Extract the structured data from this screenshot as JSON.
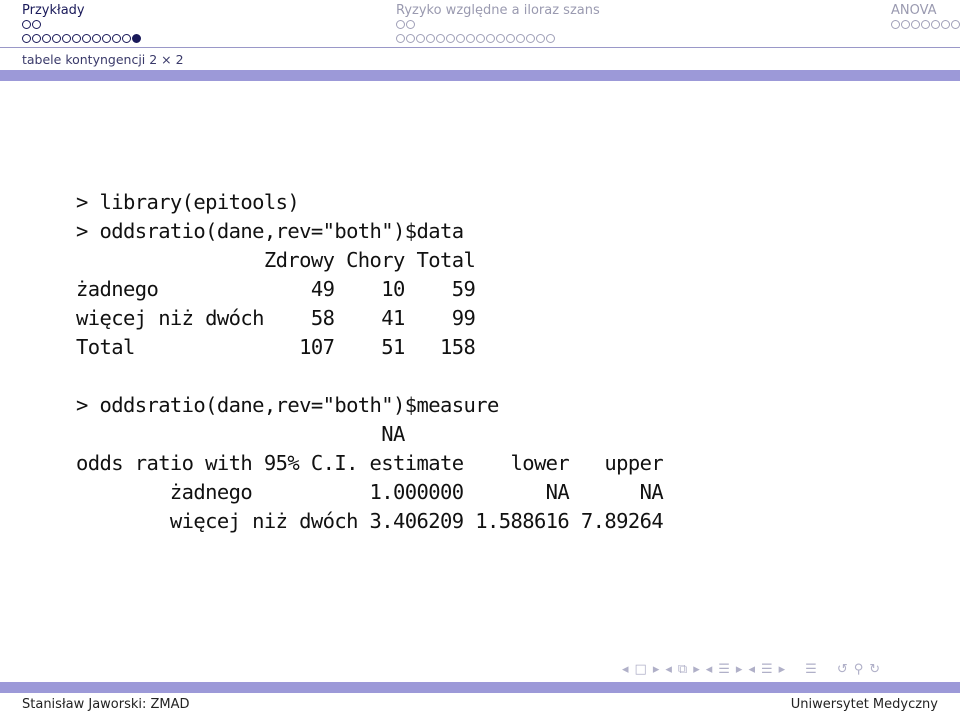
{
  "header": {
    "sections": [
      {
        "title": "Przykłady",
        "active": true,
        "rows": [
          {
            "open": 2,
            "filled": 0
          },
          {
            "open": 11,
            "filled": 1
          }
        ]
      },
      {
        "title": "Ryzyko względne a iloraz szans",
        "active": false,
        "rows": [
          {
            "open": 2,
            "filled": 0
          },
          {
            "open": 16,
            "filled": 0
          }
        ]
      },
      {
        "title": "ANOVA",
        "active": false,
        "rows": [
          {
            "open": 7,
            "filled": 0
          }
        ]
      }
    ],
    "subsection": "tabele kontyngencji 2 × 2"
  },
  "code": {
    "lines": [
      "> library(epitools)",
      "> oddsratio(dane,rev=\"both\")$data",
      "                Zdrowy Chory Total",
      "żadnego             49    10    59",
      "więcej niż dwóch    58    41    99",
      "Total              107    51   158",
      "",
      "> oddsratio(dane,rev=\"both\")$measure",
      "                          NA",
      "odds ratio with 95% C.I. estimate    lower   upper",
      "        żadnego          1.000000       NA      NA",
      "        więcej niż dwóch 3.406209 1.588616 7.89264"
    ]
  },
  "table_data": {
    "columns": [
      "Zdrowy",
      "Chory",
      "Total"
    ],
    "rows": [
      {
        "label": "żadnego",
        "values": [
          49,
          10,
          59
        ]
      },
      {
        "label": "więcej niż dwóch",
        "values": [
          58,
          41,
          99
        ]
      },
      {
        "label": "Total",
        "values": [
          107,
          51,
          158
        ]
      }
    ]
  },
  "measure_data": {
    "columns": [
      "estimate",
      "lower",
      "upper"
    ],
    "rows": [
      {
        "label": "żadnego",
        "values": [
          "1.000000",
          "NA",
          "NA"
        ]
      },
      {
        "label": "więcej niż dwóch",
        "values": [
          "3.406209",
          "1.588616",
          "7.89264"
        ]
      }
    ]
  },
  "nav_symbols": [
    "◂",
    "□",
    "▸",
    "◂",
    "⧉",
    "▸",
    "◂",
    "☰",
    "▸",
    "◂",
    "☰",
    "▸",
    "☰",
    "↺",
    "⚲",
    "↻"
  ],
  "footer": {
    "left": "Stanisław Jaworski: ZMAD",
    "right": "Uniwersytet Medyczny"
  }
}
